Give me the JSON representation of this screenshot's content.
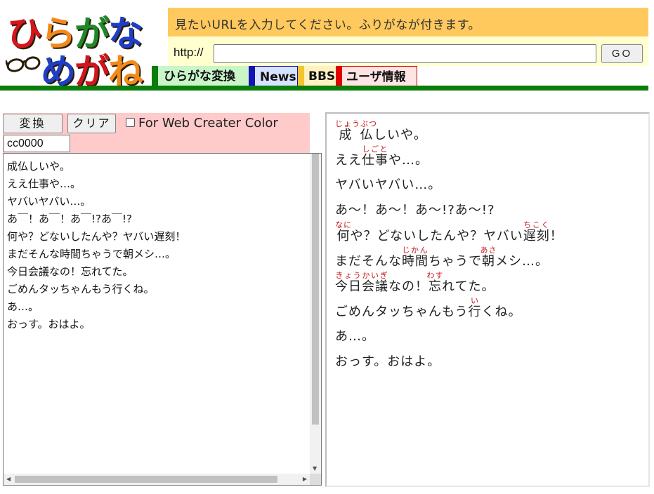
{
  "logo": {
    "line1": [
      "ひ",
      "ら",
      "が",
      "な"
    ],
    "line2": [
      "め",
      "が",
      "ね"
    ],
    "glasses_icon": "glasses-icon"
  },
  "colors": {
    "banner": "#ffc95e",
    "url_row": "#ffffd0",
    "green_rule": "#0a7d0a",
    "toolbar_pink": "#ffcaca",
    "ruby_red": "#c8151c"
  },
  "header": {
    "prompt": "見たいURLを入力してください。ふりがなが付きます。",
    "url_prefix": "http://",
    "url_value": "",
    "go_label": "GO"
  },
  "tabs": [
    {
      "label": "ひらがな変換"
    },
    {
      "label": "News"
    },
    {
      "label": "BBS"
    },
    {
      "label": "ユーザ情報"
    }
  ],
  "editor": {
    "convert_label": "変換",
    "clear_label": "クリア",
    "color_checkbox_checked": false,
    "color_checkbox_label": "For Web Creater Color",
    "color_value": "cc0000",
    "source_lines": [
      "成仏しいや。",
      "ええ仕事や…。",
      "ヤバいヤバい…。",
      "あ￣！あ￣！あ￣!?あ￣!?",
      "何や？どないしたんや？ヤバい遅刻！",
      "まだそんな時間ちゃうで朝メシ…。",
      "今日会議なの！忘れてた。",
      "ごめんタッちゃんもう行くね。",
      "あ…。",
      "おっす。おはよ。"
    ]
  },
  "result": {
    "lines": [
      [
        {
          "k": "成仏",
          "r": "じょうぶつ"
        },
        {
          "t": "しいや。"
        }
      ],
      [
        {
          "t": "ええ"
        },
        {
          "k": "仕事",
          "r": "しごと"
        },
        {
          "t": "や…。"
        }
      ],
      [
        {
          "t": "ヤバいヤバい…。"
        }
      ],
      [
        {
          "t": "あ～！あ～！あ～!?あ～!?"
        }
      ],
      [
        {
          "k": "何",
          "r": "なに"
        },
        {
          "t": "や？どないしたんや？ヤバい"
        },
        {
          "k": "遅刻",
          "r": "ちこく"
        },
        {
          "t": "！"
        }
      ],
      [
        {
          "t": "まだそんな"
        },
        {
          "k": "時間",
          "r": "じかん"
        },
        {
          "t": "ちゃうで"
        },
        {
          "k": "朝",
          "r": "あさ"
        },
        {
          "t": "メシ…。"
        }
      ],
      [
        {
          "k": "今日会議",
          "r": "きょうかいぎ"
        },
        {
          "t": "なの！"
        },
        {
          "k": "忘",
          "r": "わす"
        },
        {
          "t": "れてた。"
        }
      ],
      [
        {
          "t": "ごめんタッちゃんもう"
        },
        {
          "k": "行",
          "r": "い"
        },
        {
          "t": "くね。"
        }
      ],
      [
        {
          "t": "あ…。"
        }
      ],
      [
        {
          "t": "おっす。おはよ。"
        }
      ]
    ]
  }
}
